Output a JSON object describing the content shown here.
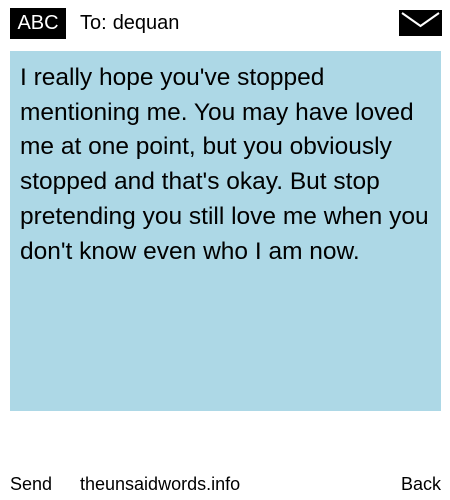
{
  "header": {
    "badge_label": "ABC",
    "to_prefix": "To:",
    "recipient": "dequan",
    "envelope_icon": "envelope-icon"
  },
  "message": {
    "text": "I really hope you've stopped mentioning me. You may have loved me at one point, but you obviously stopped and that's okay. But stop pretending you still love me when you don't know even who I am now.",
    "background_color": "#add8e6"
  },
  "footer": {
    "send_label": "Send",
    "site_label": "theunsaidwords.info",
    "back_label": "Back"
  }
}
